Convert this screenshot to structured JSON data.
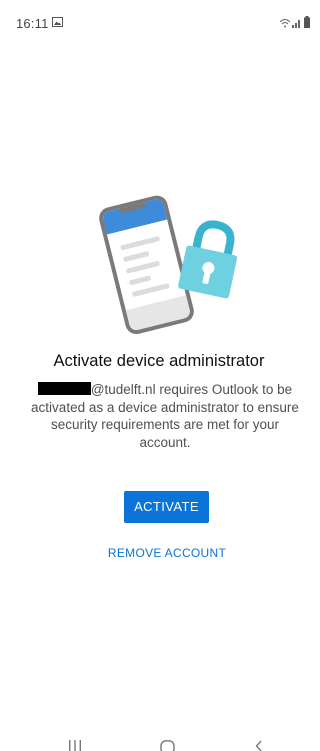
{
  "status_bar": {
    "time": "16:11"
  },
  "dialog": {
    "title": "Activate device administrator",
    "description_suffix": "@tudelft.nl requires Outlook to be activated as a device administrator to ensure security requirements are met for your account.",
    "activate_label": "ACTIVATE",
    "remove_account_label": "REMOVE ACCOUNT"
  },
  "colors": {
    "accent": "#0a74d9",
    "phone_frame": "#7a7a7a",
    "phone_header": "#3d8bd9",
    "lock_body": "#6fd0e0",
    "lock_shackle": "#38b4cf"
  },
  "icons": {
    "status": [
      "gallery-icon",
      "wifi-icon",
      "signal-icon",
      "battery-icon"
    ],
    "nav": [
      "recents-icon",
      "home-icon",
      "back-icon"
    ]
  }
}
